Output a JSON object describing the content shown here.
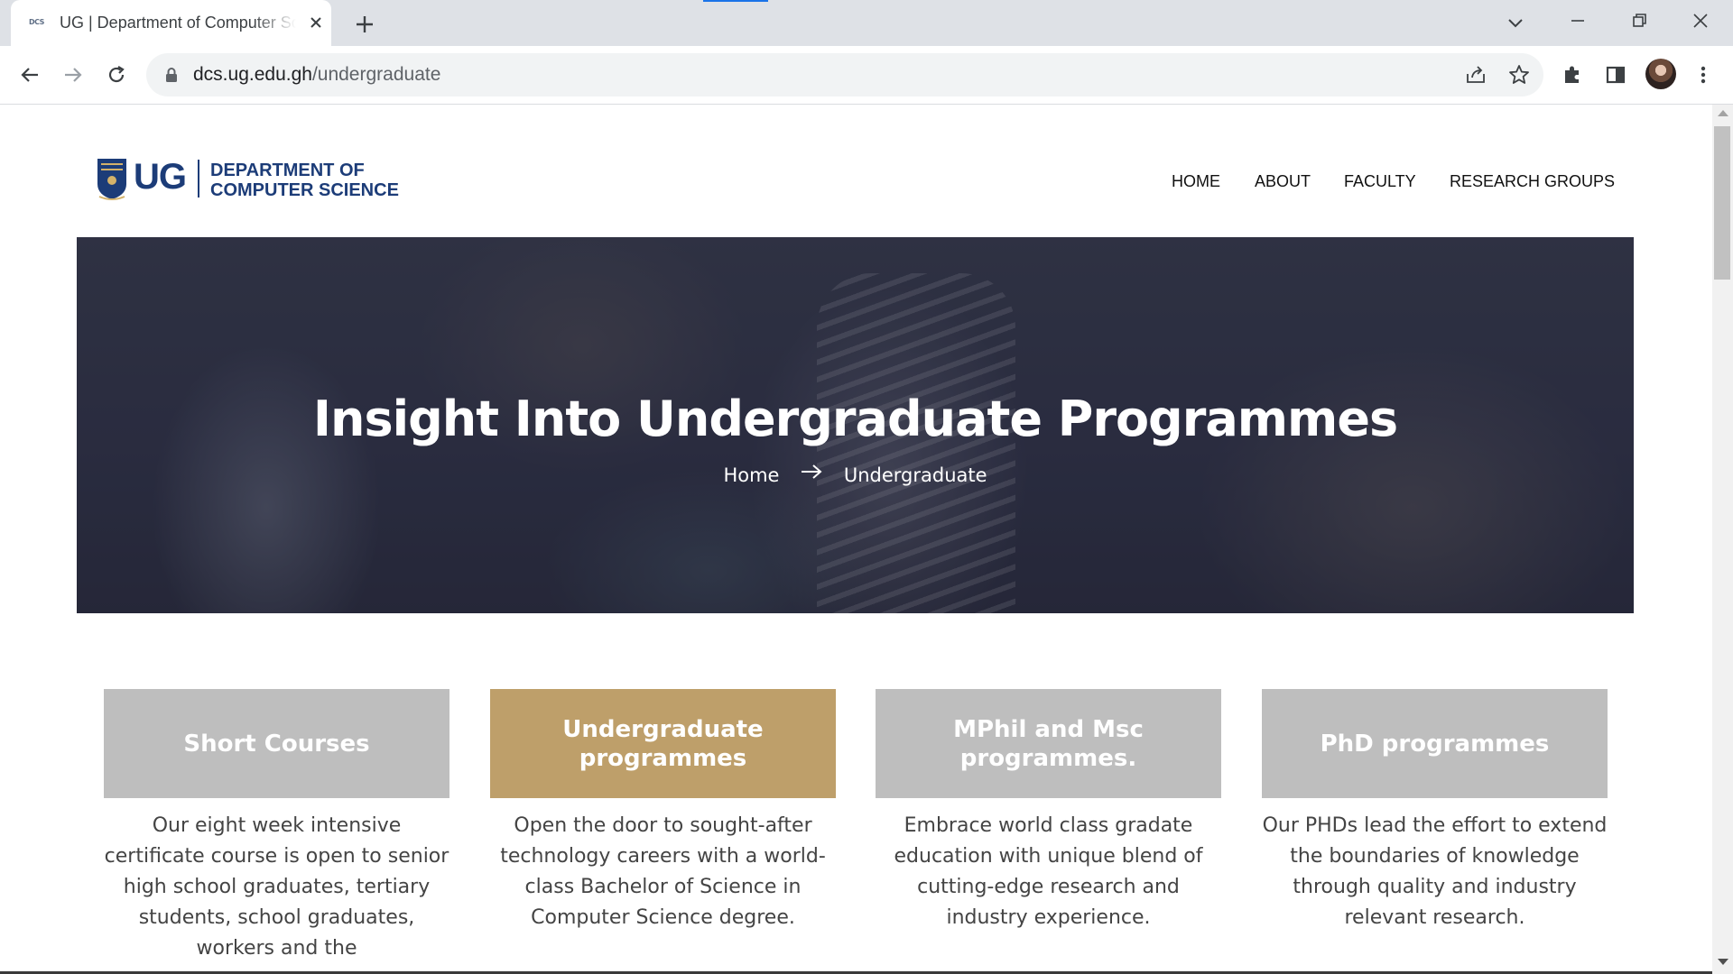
{
  "browser": {
    "tab_title": "UG | Department of Computer Science",
    "favicon_text": "DCS",
    "url_host": "dcs.ug.edu.gh",
    "url_path": "/undergraduate"
  },
  "site": {
    "logo": {
      "ug": "UG",
      "dept_line1": "DEPARTMENT OF",
      "dept_line2": "COMPUTER SCIENCE"
    },
    "nav": [
      "HOME",
      "ABOUT",
      "FACULTY",
      "RESEARCH GROUPS"
    ],
    "hero": {
      "title": "Insight Into Undergraduate Programmes",
      "breadcrumb_home": "Home",
      "breadcrumb_current": "Undergraduate"
    },
    "cards": [
      {
        "title": "Short Courses",
        "desc": "Our eight week intensive certificate course is open to senior high school graduates, tertiary students, school graduates, workers and the"
      },
      {
        "title": "Undergraduate programmes",
        "desc": "Open the door to sought-after technology careers with a world-class Bachelor of Science in Computer Science degree."
      },
      {
        "title": "MPhil and Msc programmes.",
        "desc": "Embrace world class gradate education with unique blend of cutting-edge research and industry experience."
      },
      {
        "title": "PhD programmes",
        "desc": "Our PHDs lead the effort to extend the boundaries of knowledge through quality and industry relevant research."
      }
    ]
  },
  "colors": {
    "brand_navy": "#1c3c78",
    "card_active": "#be9f6a",
    "card_inactive": "#bebebe"
  }
}
